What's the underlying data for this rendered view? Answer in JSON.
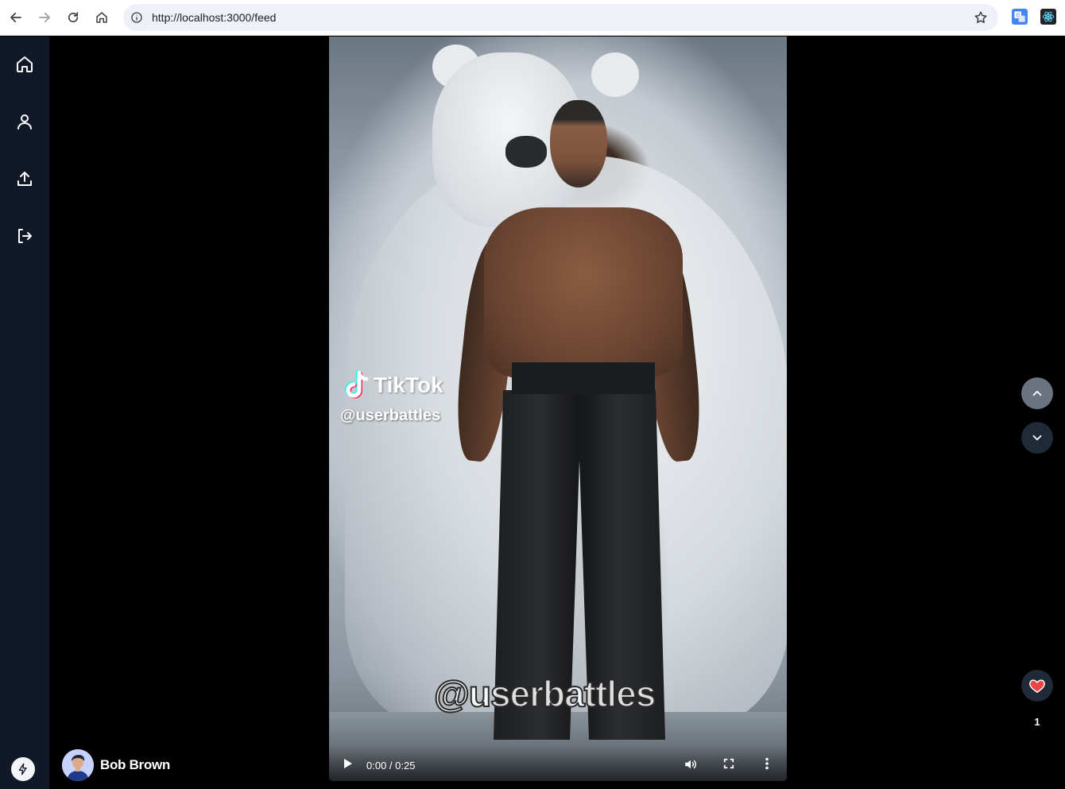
{
  "browser": {
    "url": "http://localhost:3000/feed"
  },
  "sidebar": {
    "items": [
      {
        "name": "home",
        "icon": "home-icon"
      },
      {
        "name": "profile",
        "icon": "user-icon"
      },
      {
        "name": "upload",
        "icon": "upload-icon"
      },
      {
        "name": "logout",
        "icon": "logout-icon"
      }
    ],
    "footer_icon": "bolt-icon"
  },
  "video": {
    "overlay_brand": "TikTok",
    "overlay_handle": "@userbattles",
    "watermark": "@userbattles",
    "time": "0:00 / 0:25"
  },
  "actions": {
    "up_icon": "chevron-up-icon",
    "down_icon": "chevron-down-icon",
    "like_icon": "heart-icon",
    "like_count": "1"
  },
  "user": {
    "name": "Bob Brown"
  },
  "colors": {
    "sidebar_bg": "#111827",
    "nav_up_bg": "#6b7280",
    "nav_down_bg": "#1f2937",
    "heart": "#ef4444"
  }
}
